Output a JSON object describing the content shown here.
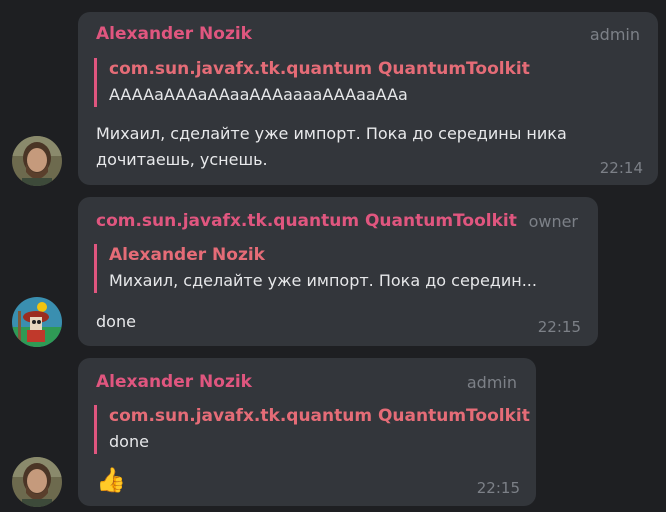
{
  "messages": [
    {
      "sender": "Alexander Nozik",
      "role": "admin",
      "reply": {
        "author": "com.sun.javafx.tk.quantum QuantumToolkit",
        "text": "AAAAaAAAaAAaaAAAaaaaAAAaaAAa"
      },
      "text": "Михаил, сделайте уже импорт. Пока до середины ника дочитаешь, уснешь.",
      "time": "22:14",
      "avatar": "avatar-bearded-man"
    },
    {
      "sender": "com.sun.javafx.tk.quantum QuantumToolkit",
      "role": "owner",
      "reply": {
        "author": "Alexander Nozik",
        "text": "Михаил, сделайте уже импорт. Пока до середин..."
      },
      "text": "done",
      "time": "22:15",
      "avatar": "avatar-cartoon-character"
    },
    {
      "sender": "Alexander Nozik",
      "role": "admin",
      "reply": {
        "author": "com.sun.javafx.tk.quantum QuantumToolkit",
        "text": "done"
      },
      "text": "👍",
      "time": "22:15",
      "avatar": "avatar-bearded-man"
    }
  ],
  "colors": {
    "background": "#1e1f22",
    "bubble": "#33363b",
    "accent": "#e0567f",
    "muted": "#7c8087"
  }
}
